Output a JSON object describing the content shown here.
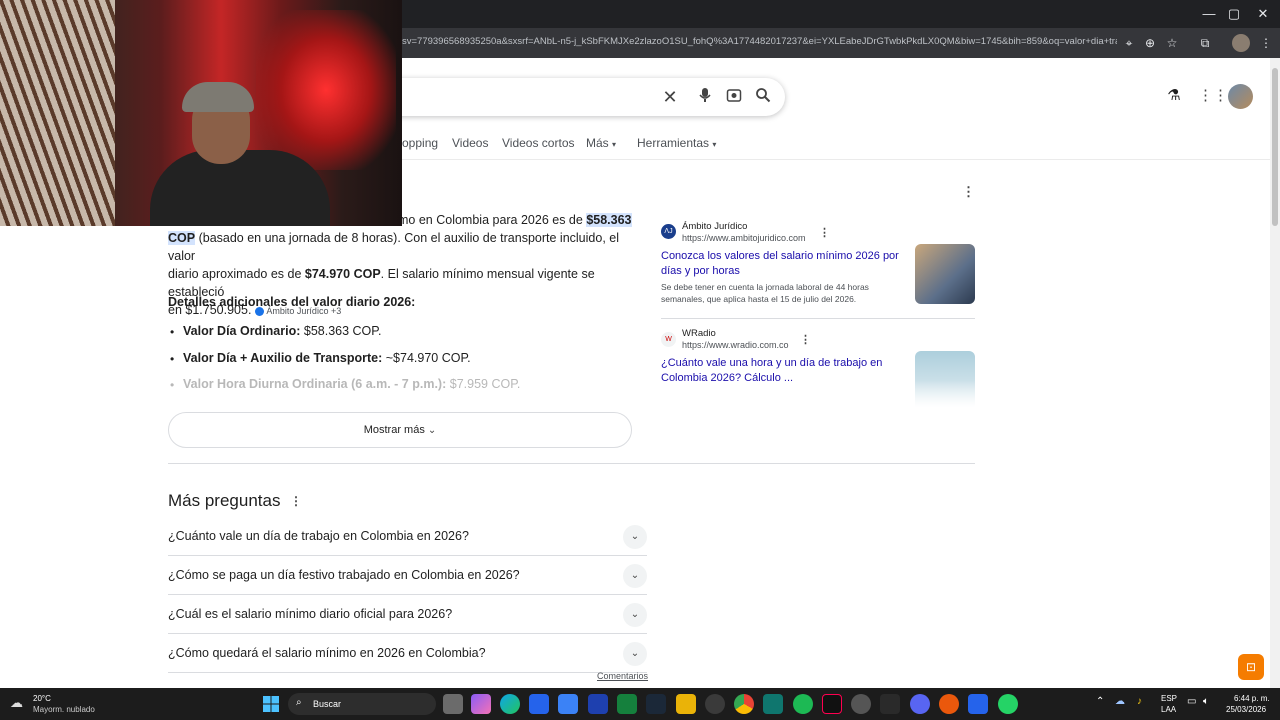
{
  "browser": {
    "url": "sv=779396568935250a&sxsrf=ANbL-n5-j_kSbFKMJXe2zlazoO1SU_fohQ%3A1774482017237&ei=YXLEabeJDrGTwbkPkdLX0QM&biw=1745&bih=859&oq=valor+dia+trabaj...",
    "window_controls": [
      "—",
      "▢",
      "✕"
    ]
  },
  "search": {
    "tabs": [
      "opping",
      "Videos",
      "Videos cortos",
      "Más",
      "Herramientas"
    ]
  },
  "answer": {
    "line1_start": "mo en Colombia para 2026 es de",
    "line1_highlight": "$58.363",
    "line2_highlight": "COP",
    "line2_rest": "(basado en una jornada de 8 horas). Con el auxilio de transporte incluido, el valor",
    "line3_start": "diario aproximado es de",
    "line3_bold": "$74.970 COP",
    "line3_rest": ". El salario mínimo mensual vigente se estableció",
    "line4": "en $1.750.905.",
    "source_chip": "Ámbito Jurídico +3",
    "details_heading": "Detalles adicionales del valor diario 2026:",
    "bullets": [
      {
        "label": "Valor Día Ordinario:",
        "value": "$58.363 COP."
      },
      {
        "label": "Valor Día + Auxilio de Transporte:",
        "value": "~$74.970 COP."
      },
      {
        "label": "Valor Hora Diurna Ordinaria (6 a.m. - 7 p.m.):",
        "value": "$7.959 COP."
      }
    ],
    "show_more": "Mostrar más"
  },
  "sources": [
    {
      "site": "Ámbito Jurídico",
      "url": "https://www.ambitojuridico.com",
      "title": "Conozca los valores del salario mínimo 2026 por días y por horas",
      "desc": "Se debe tener en cuenta la jornada laboral de 44 horas semanales, que aplica hasta el 15 de julio del 2026."
    },
    {
      "site": "WRadio",
      "url": "https://www.wradio.com.co",
      "title": "¿Cuánto vale una hora y un día de trabajo en Colombia 2026? Cálculo ...",
      "desc": ""
    }
  ],
  "more_questions": {
    "heading": "Más preguntas",
    "items": [
      "¿Cuánto vale un día de trabajo en Colombia en 2026?",
      "¿Cómo se paga un día festivo trabajado en Colombia en 2026?",
      "¿Cuál es el salario mínimo diario oficial para 2026?",
      "¿Cómo quedará el salario mínimo en 2026 en Colombia?"
    ],
    "feedback": "Comentarios"
  },
  "taskbar": {
    "weather_temp": "20°C",
    "weather_desc": "Mayorm. nublado",
    "search_label": "Buscar",
    "lang_top": "ESP",
    "lang_bottom": "LAA",
    "time": "6:44 p. m.",
    "date": "25/03/2026"
  }
}
